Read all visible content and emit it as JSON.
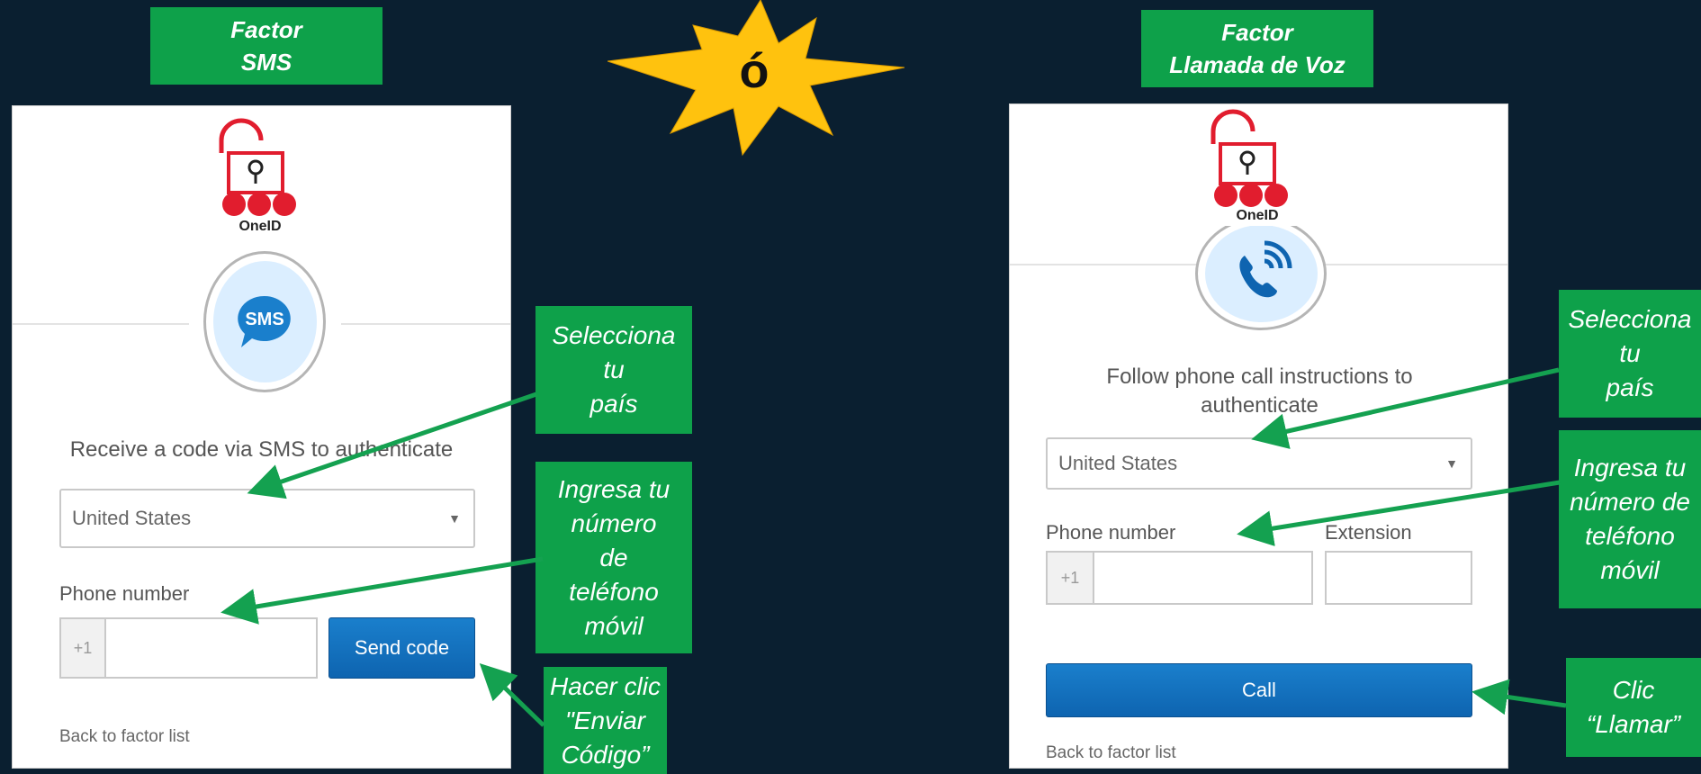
{
  "colors": {
    "background": "#0a1f30",
    "label_green": "#0ea14a",
    "arrow_green": "#14a150",
    "button_blue": "#1373c0",
    "star_yellow": "#ffc20e"
  },
  "top_labels": {
    "sms": "Factor\nSMS",
    "voice": "Factor\nLlamada de Voz"
  },
  "or_symbol": "ó",
  "sms_card": {
    "logo_text": "OneID",
    "factor_icon": "sms-bubble-icon",
    "factor_icon_text": "SMS",
    "prompt": "Receive a code via SMS to authenticate",
    "country_value": "United States",
    "phone_label": "Phone number",
    "phone_prefix": "+1",
    "phone_value": "",
    "send_button": "Send code",
    "back_link": "Back to factor list"
  },
  "voice_card": {
    "logo_text": "OneID",
    "factor_icon": "phone-call-icon",
    "prompt": "Follow phone call instructions to authenticate",
    "country_value": "United States",
    "phone_label": "Phone number",
    "extension_label": "Extension",
    "phone_prefix": "+1",
    "phone_value": "",
    "extension_value": "",
    "call_button": "Call",
    "back_link": "Back to factor list"
  },
  "callouts": {
    "sms_country": "Selecciona\ntu\npaís",
    "sms_phone": "Ingresa tu\nnúmero\nde\nteléfono\nmóvil",
    "sms_click": "Hacer clic\n\"Enviar\nCódigo”",
    "voice_country": "Selecciona\ntu\npaís",
    "voice_phone": "Ingresa tu\nnúmero de\nteléfono\nmóvil",
    "voice_click": "Clic\n“Llamar”"
  }
}
